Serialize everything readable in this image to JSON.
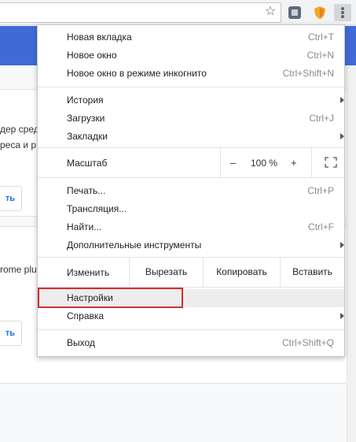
{
  "toolbar": {
    "icons": [
      "star-icon",
      "puzzle-extension-icon",
      "shield-extension-icon",
      "kebab-menu-icon"
    ],
    "colors": {
      "kebab_active_bg": "#d4d6d8"
    }
  },
  "background": {
    "partial_texts": [
      "дер сред",
      "реса и р",
      "ть",
      "rome plu",
      "ть"
    ],
    "accent": "#3f6ad8"
  },
  "menu": {
    "group1": [
      {
        "label": "Новая вкладка",
        "shortcut": "Ctrl+T"
      },
      {
        "label": "Новое окно",
        "shortcut": "Ctrl+N"
      },
      {
        "label": "Новое окно в режиме инкогнито",
        "shortcut": "Ctrl+Shift+N"
      }
    ],
    "group2": [
      {
        "label": "История",
        "shortcut": "",
        "submenu": true
      },
      {
        "label": "Загрузки",
        "shortcut": "Ctrl+J"
      },
      {
        "label": "Закладки",
        "shortcut": "",
        "submenu": true
      }
    ],
    "zoom": {
      "label": "Масштаб",
      "minus": "–",
      "value": "100 %",
      "plus": "+"
    },
    "group3": [
      {
        "label": "Печать...",
        "shortcut": "Ctrl+P"
      },
      {
        "label": "Трансляция...",
        "shortcut": ""
      },
      {
        "label": "Найти...",
        "shortcut": "Ctrl+F"
      },
      {
        "label": "Дополнительные инструменты",
        "shortcut": "",
        "submenu": true
      }
    ],
    "edit": {
      "label": "Изменить",
      "cut": "Вырезать",
      "copy": "Копировать",
      "paste": "Вставить"
    },
    "group4": [
      {
        "label": "Настройки",
        "shortcut": "",
        "highlighted": true
      },
      {
        "label": "Справка",
        "shortcut": "",
        "submenu": true
      }
    ],
    "exit": {
      "label": "Выход",
      "shortcut": "Ctrl+Shift+Q"
    }
  },
  "annotation": {
    "color": "#d32f2f"
  }
}
